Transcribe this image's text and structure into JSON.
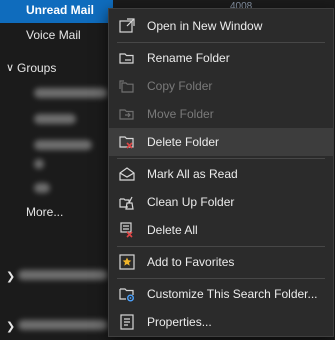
{
  "folders": {
    "unread_mail": "Unread Mail",
    "unread_count": "4008",
    "voice_mail": "Voice Mail",
    "groups": "Groups",
    "groups_chevron": "∨",
    "more": "More...",
    "collapsed_chevron": "❯"
  },
  "menu": {
    "items": [
      {
        "label": "Open in New Window",
        "icon": "open-window-icon",
        "enabled": true
      },
      {
        "label": "Rename Folder",
        "icon": "rename-folder-icon",
        "enabled": true
      },
      {
        "label": "Copy Folder",
        "icon": "copy-folder-icon",
        "enabled": false
      },
      {
        "label": "Move Folder",
        "icon": "move-folder-icon",
        "enabled": false
      },
      {
        "label": "Delete Folder",
        "icon": "delete-folder-icon",
        "enabled": true,
        "highlighted": true
      },
      {
        "label": "Mark All as Read",
        "icon": "mark-all-read-icon",
        "enabled": true
      },
      {
        "label": "Clean Up Folder",
        "icon": "clean-up-folder-icon",
        "enabled": true
      },
      {
        "label": "Delete All",
        "icon": "delete-all-icon",
        "enabled": true
      },
      {
        "label": "Add to Favorites",
        "icon": "favorites-star-icon",
        "enabled": true
      },
      {
        "label": "Customize This Search Folder...",
        "icon": "customize-search-icon",
        "enabled": true
      },
      {
        "label": "Properties...",
        "icon": "properties-icon",
        "enabled": true
      }
    ]
  },
  "colors": {
    "accent": "#0f6cbd",
    "menu_bg": "#2b2b2b",
    "hover_bg": "#3d3d3d",
    "delete_red": "#e04646",
    "star_yellow": "#f0b429"
  }
}
